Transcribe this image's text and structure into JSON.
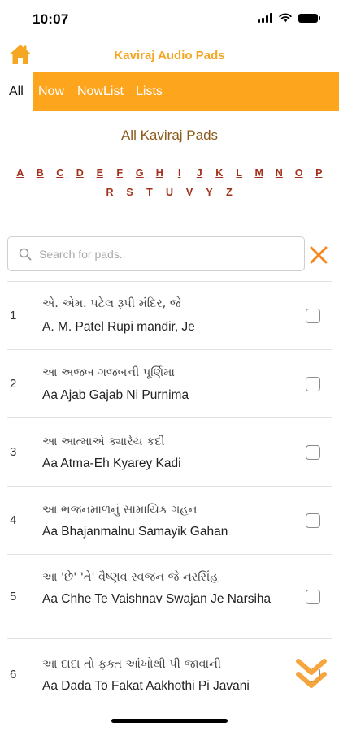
{
  "status_bar": {
    "time": "10:07"
  },
  "header": {
    "title": "Kaviraj Audio Pads",
    "home_icon": "home-icon"
  },
  "tabs": [
    {
      "label": "All",
      "active": true
    },
    {
      "label": "Now",
      "active": false
    },
    {
      "label": "NowList",
      "active": false
    },
    {
      "label": "Lists",
      "active": false
    }
  ],
  "section_title": "All Kaviraj Pads",
  "alphabet": {
    "row1": [
      "A",
      "B",
      "C",
      "D",
      "E",
      "F",
      "G",
      "H",
      "I",
      "J",
      "K",
      "L",
      "M",
      "N",
      "O",
      "P"
    ],
    "row2": [
      "R",
      "S",
      "T",
      "U",
      "V",
      "Y",
      "Z"
    ]
  },
  "search": {
    "placeholder": "Search for pads..",
    "value": ""
  },
  "pads": [
    {
      "num": "1",
      "gujarati": "એ. એમ. પટેલ રૂપી મંદિર, જે",
      "english": "A. M. Patel Rupi mandir, Je",
      "checked": false
    },
    {
      "num": "2",
      "gujarati": "આ અજબ ગજબની પૂર્ણિમા",
      "english": "Aa Ajab Gajab Ni Purnima",
      "checked": false
    },
    {
      "num": "3",
      "gujarati": "આ આત્માએ ક્યારેય કદી",
      "english": "Aa Atma-Eh Kyarey Kadi",
      "checked": false
    },
    {
      "num": "4",
      "gujarati": "આ ભજનમાળનું સામાયિક ગહન",
      "english": "Aa Bhajanmalnu Samayik Gahan",
      "checked": false
    },
    {
      "num": "5",
      "gujarati": "આ 'છે' 'તે' વૈષ્ણવ સ્વજન જે નરસિંહ",
      "english": "Aa Chhe Te Vaishnav Swajan Je Narsiha",
      "checked": false
    },
    {
      "num": "6",
      "gujarati": "આ દાદા તો ફક્ત આંખોથી પી જાવાની",
      "english": "Aa Dada To Fakat Aakhothi Pi Javani",
      "checked": false
    }
  ],
  "colors": {
    "accent": "#fca51d",
    "title": "#f5a623",
    "alphabet": "#a0301c",
    "section_title": "#8a5a1a"
  }
}
